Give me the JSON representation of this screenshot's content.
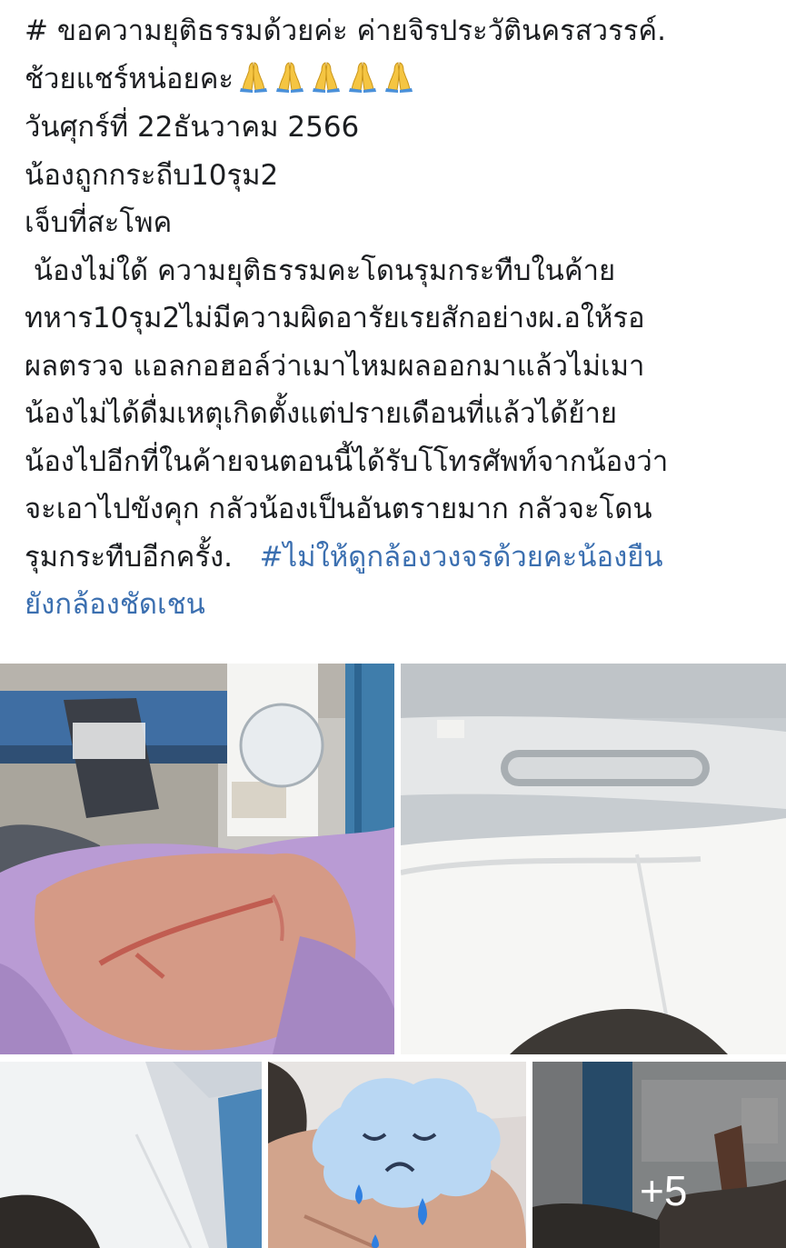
{
  "post": {
    "line1": "# ขอความยุติธรรมด้วยค่ะ ค่ายจิรประวัตินครสวรรค์.",
    "line2": "ช้วยแชร์หน่อยคะ",
    "prayer_emoji_count": 5,
    "line3": "วันศุกร์ที่ 22ธันวาคม 2566",
    "line4": "น้องถูกกระถีบ10รุม2",
    "line5": "เจ็บที่สะโพค",
    "line6": " น้องไม่ใด้ ความยุติธรรมคะโดนรุมกระทืบในค้าย",
    "line7": "ทหาร10รุม2ไม่มีความผิดอารัยเรยสักอย่างผ.อให้รอ",
    "line8": "ผลตรวจ แอลกอฮอล์ว่าเมาไหมผลออกมาแล้วไม่เมา",
    "line9": "น้องไม่ได้ดื่มเหตุเกิดตั้งแต่ปรายเดือนที่แล้วได้ย้าย",
    "line10": "น้องไปอีกที่ในค้ายจนตอนนี้ได้รับโโทรศัพท์จากน้องว่า",
    "line11": "จะเอาไปขังคุก กลัวน้องเป็นอันตรายมาก กลัวจะโดน",
    "line12_text": "รุมกระทืบอีกครั้ง.",
    "line12_hashtag": "#ไม่ให้ดูกล้องวงจรด้วยคะน้องยืน",
    "line13_hashtag": "ยังกล้องชัดเชน"
  },
  "photos": {
    "more_label": "+5"
  },
  "colors": {
    "text": "#1c1e21",
    "hashtag": "#3b6fb0",
    "background": "#ffffff"
  }
}
